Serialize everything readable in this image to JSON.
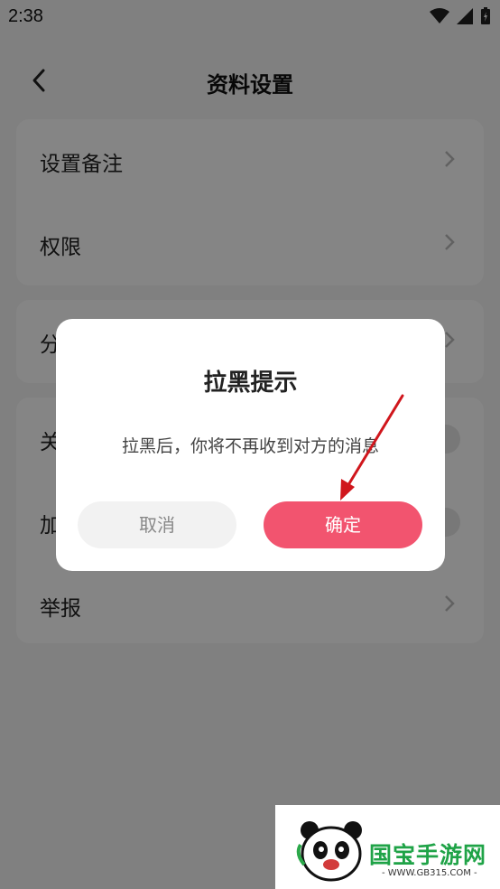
{
  "status_bar": {
    "time": "2:38"
  },
  "header": {
    "title": "资料设置"
  },
  "settings": {
    "group1": [
      "设置备注",
      "权限"
    ],
    "group2": [
      "分"
    ],
    "group3": [
      "关",
      "加",
      "举报"
    ]
  },
  "dialog": {
    "title": "拉黑提示",
    "message": "拉黑后，你将不再收到对方的消息",
    "cancel": "取消",
    "confirm": "确定"
  },
  "watermark": {
    "brand": "国宝手游网",
    "url": "- WWW.GB315.COM -"
  },
  "colors": {
    "accent": "#f2546f",
    "arrow": "#d0161c",
    "brand": "#1fa347"
  }
}
